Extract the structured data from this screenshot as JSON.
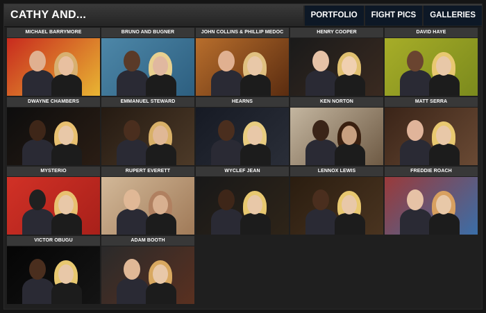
{
  "header": {
    "title": "CATHY AND...",
    "nav": [
      "PORTFOLIO",
      "FIGHT PICS",
      "GALLERIES"
    ]
  },
  "gallery": [
    {
      "caption": "MICHAEL BARRYMORE",
      "bg": [
        "#c82a1e",
        "#e8b533"
      ]
    },
    {
      "caption": "BRUNO AND BUGNER",
      "bg": [
        "#4d87a8",
        "#2d5f80"
      ]
    },
    {
      "caption": "JOHN COLLINS & PHILLIP MEDOC",
      "bg": [
        "#b86e2c",
        "#5a2c10"
      ]
    },
    {
      "caption": "HENRY COOPER",
      "bg": [
        "#1a1a1a",
        "#3a2a20"
      ]
    },
    {
      "caption": "DAVID HAYE",
      "bg": [
        "#a7ad28",
        "#7b8a1d"
      ]
    },
    {
      "caption": "DWAYNE CHAMBERS",
      "bg": [
        "#0d0d0d",
        "#2a1d14"
      ]
    },
    {
      "caption": "EMMANUEL STEWARD",
      "bg": [
        "#241a12",
        "#4d3a28"
      ]
    },
    {
      "caption": "HEARNS",
      "bg": [
        "#161a24",
        "#2a2e38"
      ]
    },
    {
      "caption": "KEN NORTON",
      "bg": [
        "#c4b6a0",
        "#6e5a44"
      ]
    },
    {
      "caption": "MATT SERRA",
      "bg": [
        "#3a2418",
        "#6a4a34"
      ]
    },
    {
      "caption": "MYSTERIO",
      "bg": [
        "#d13126",
        "#a8201a"
      ]
    },
    {
      "caption": "RUPERT EVERETT",
      "bg": [
        "#d2b898",
        "#a07a58"
      ]
    },
    {
      "caption": "WYCLEF JEAN",
      "bg": [
        "#181818",
        "#2e2418"
      ]
    },
    {
      "caption": "LENNOX LEWIS",
      "bg": [
        "#2a1d10",
        "#4a3420"
      ]
    },
    {
      "caption": "FREDDIE ROACH",
      "bg": [
        "#9a3a3a",
        "#3a6ea8"
      ]
    },
    {
      "caption": "VICTOR OBUGU",
      "bg": [
        "#050505",
        "#141414"
      ]
    },
    {
      "caption": "ADAM BOOTH",
      "bg": [
        "#2a2a2a",
        "#5a3020"
      ]
    }
  ]
}
